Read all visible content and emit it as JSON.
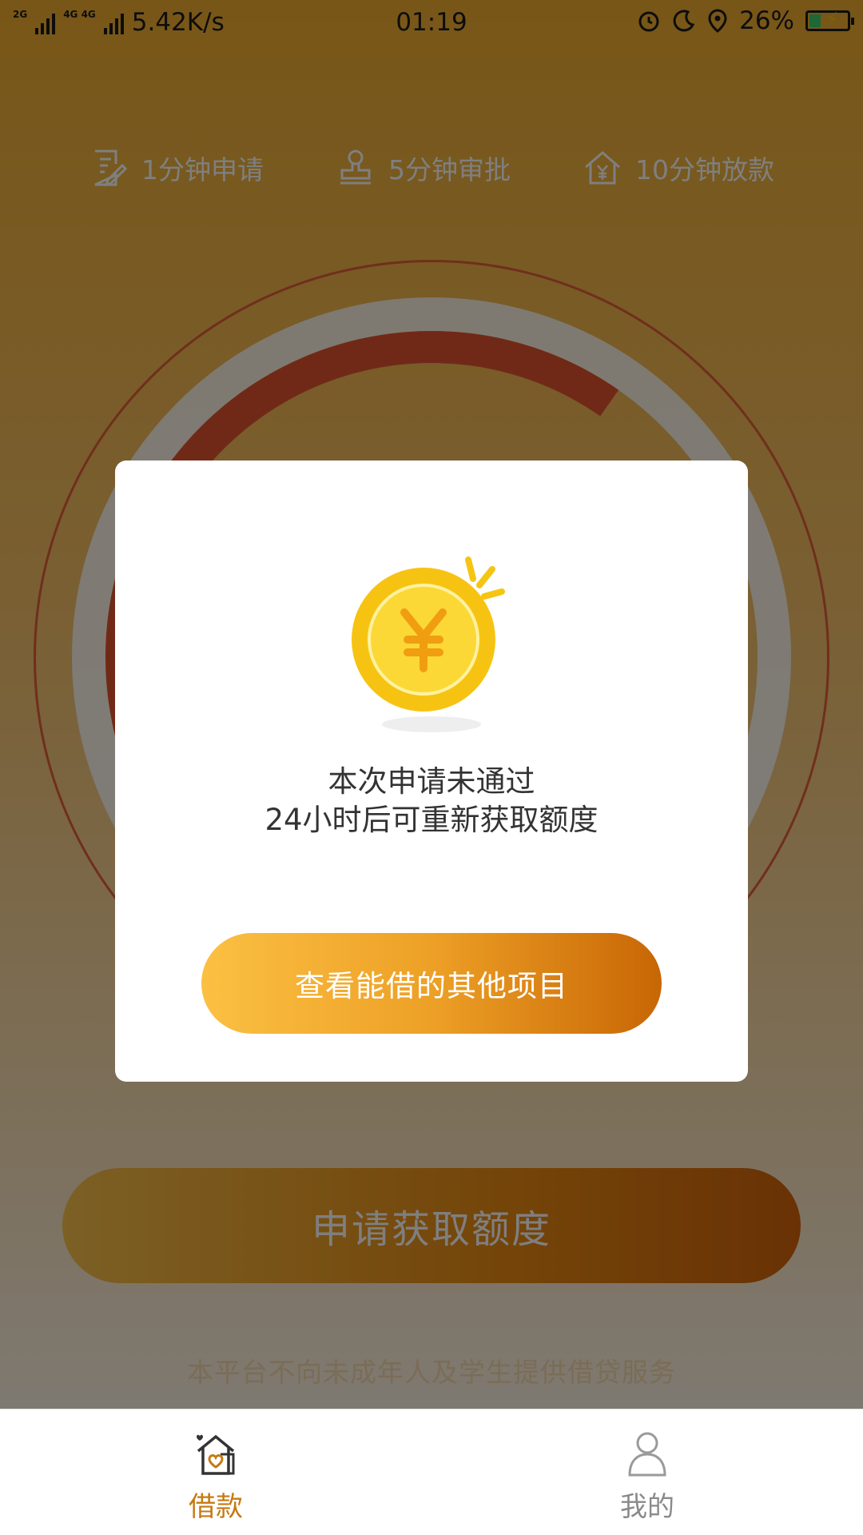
{
  "status_bar": {
    "network_speed": "5.42K/s",
    "time": "01:19",
    "battery": "26%",
    "sig1_label": "2G",
    "sig2_label": "4G 4G"
  },
  "features": [
    {
      "icon": "edit-document-icon",
      "label": "1分钟申请"
    },
    {
      "icon": "stamp-icon",
      "label": "5分钟审批"
    },
    {
      "icon": "house-yuan-icon",
      "label": "10分钟放款"
    }
  ],
  "main": {
    "apply_button": "申请获取额度",
    "disclaimer": "本平台不向未成年人及学生提供借贷服务"
  },
  "modal": {
    "icon": "gold-coin-yuan-icon",
    "line1": "本次申请未通过",
    "line2": "24小时后可重新获取额度",
    "button": "查看能借的其他项目"
  },
  "bottom_nav": {
    "loan": {
      "label": "借款",
      "icon": "house-heart-icon",
      "active": true
    },
    "mine": {
      "label": "我的",
      "icon": "person-icon",
      "active": false
    }
  },
  "colors": {
    "accent": "#e98a12",
    "active_nav": "#c67a12"
  }
}
